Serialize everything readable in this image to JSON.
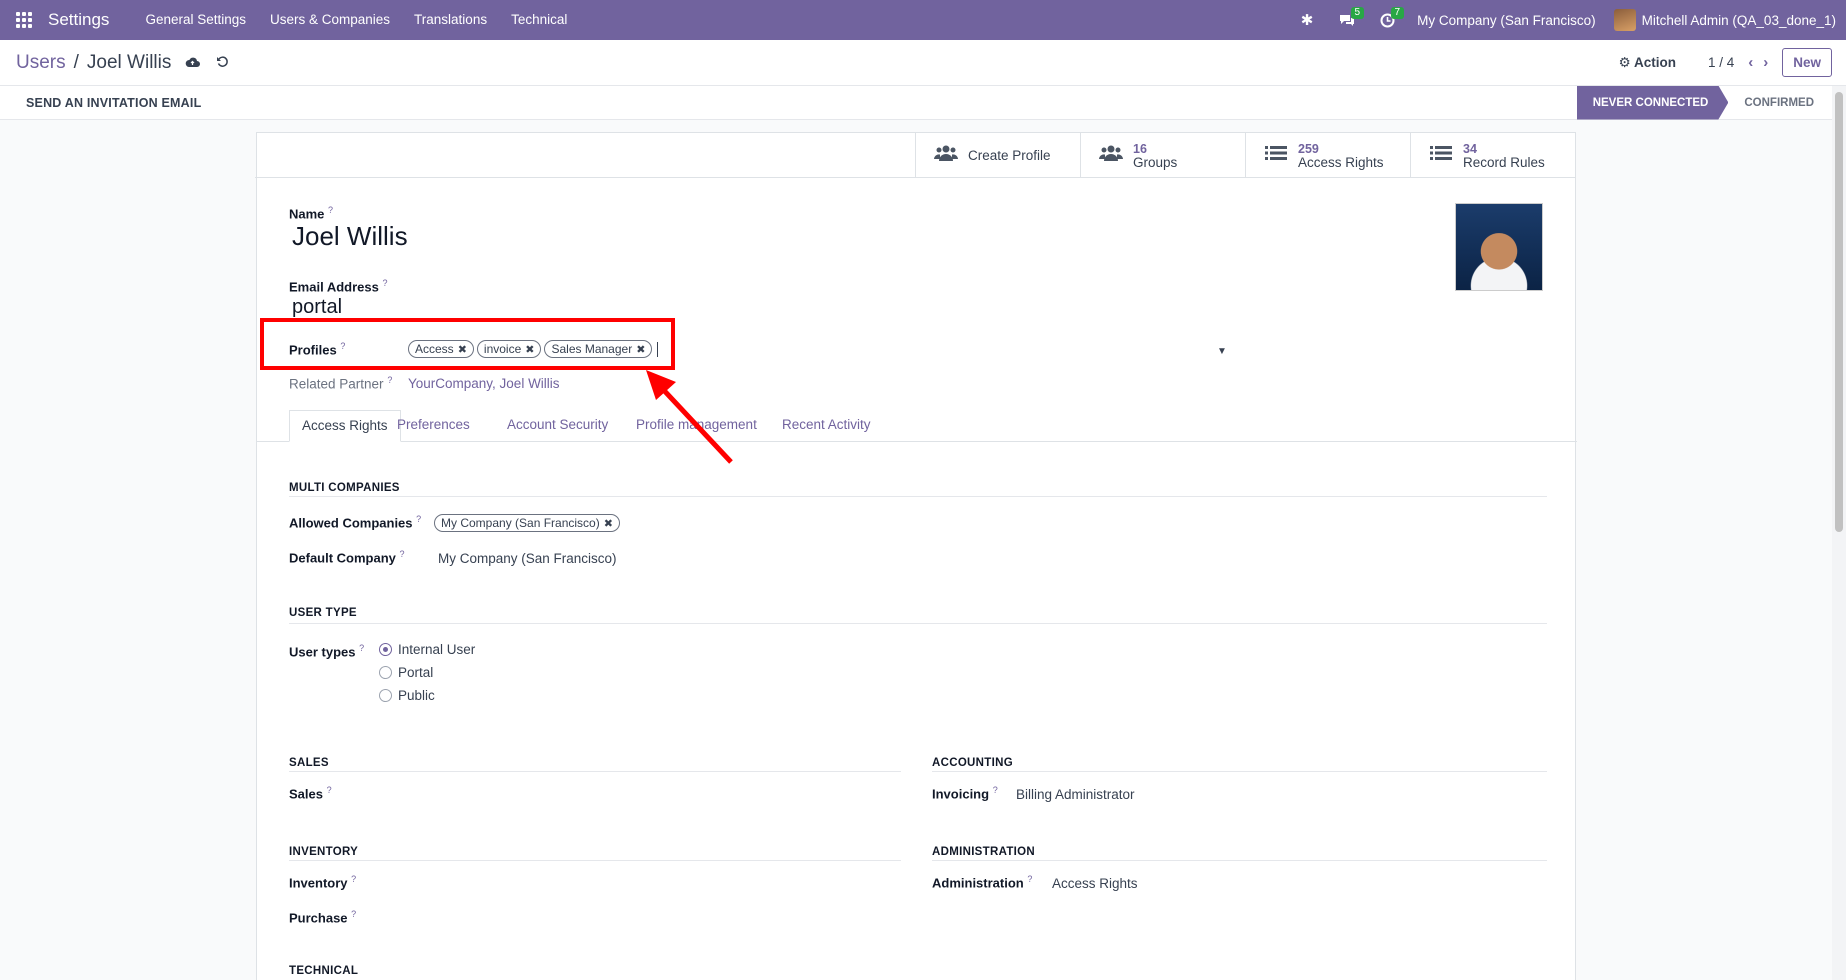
{
  "navbar": {
    "brand": "Settings",
    "menu": [
      "General Settings",
      "Users & Companies",
      "Translations",
      "Technical"
    ],
    "messages_count": "5",
    "activities_count": "7",
    "company": "My Company (San Francisco)",
    "user": "Mitchell Admin (QA_03_done_1)"
  },
  "control": {
    "breadcrumb_parent": "Users",
    "breadcrumb_sep": "/",
    "breadcrumb_current": "Joel Willis",
    "action_label": "Action",
    "pager": "1 / 4",
    "new_label": "New"
  },
  "statusbar": {
    "invite_label": "SEND AN INVITATION EMAIL",
    "steps": [
      "NEVER CONNECTED",
      "CONFIRMED"
    ]
  },
  "stat_buttons": {
    "create_profile": "Create Profile",
    "groups_value": "16",
    "groups_label": "Groups",
    "access_value": "259",
    "access_label": "Access Rights",
    "rules_value": "34",
    "rules_label": "Record Rules"
  },
  "form": {
    "name_label": "Name",
    "name_value": "Joel Willis",
    "email_label": "Email Address",
    "email_value": "portal",
    "profiles_label": "Profiles",
    "profiles": [
      "Access",
      "invoice",
      "Sales Manager"
    ],
    "related_partner_label": "Related Partner",
    "related_partner_value": "YourCompany, Joel Willis",
    "help_mark": "?"
  },
  "tabs": [
    "Access Rights",
    "Preferences",
    "Account Security",
    "Profile management",
    "Recent Activity"
  ],
  "access": {
    "multi_companies_title": "MULTI COMPANIES",
    "allowed_companies_label": "Allowed Companies",
    "allowed_companies": [
      "My Company (San Francisco)"
    ],
    "default_company_label": "Default Company",
    "default_company_value": "My Company (San Francisco)",
    "user_type_title": "USER TYPE",
    "user_types_label": "User types",
    "user_types": [
      "Internal User",
      "Portal",
      "Public"
    ],
    "user_type_selected": "Internal User",
    "sales_title": "SALES",
    "sales_label": "Sales",
    "accounting_title": "ACCOUNTING",
    "invoicing_label": "Invoicing",
    "invoicing_value": "Billing Administrator",
    "inventory_title": "INVENTORY",
    "inventory_label": "Inventory",
    "purchase_label": "Purchase",
    "administration_title": "ADMINISTRATION",
    "administration_label": "Administration",
    "administration_value": "Access Rights",
    "technical_title": "TECHNICAL"
  },
  "colors": {
    "brand": "#71639e",
    "annotation": "#ff0000"
  }
}
